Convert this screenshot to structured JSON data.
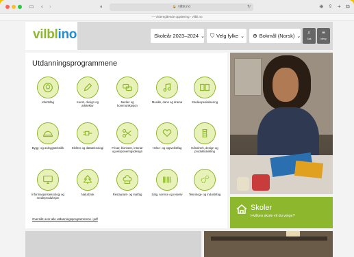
{
  "browser": {
    "url": "vilbli.no",
    "banner": "— Videregående opplæring - vilbli.no"
  },
  "header": {
    "logo_text_1": "vilbl",
    "logo_text_2": "i",
    "logo_text_3": "no",
    "school_year": "Skoleår 2023–2024",
    "county": "Velg fylke",
    "language": "Bokmål (Norsk)",
    "search_label": "Søk",
    "menu_label": "Meny"
  },
  "programs": {
    "title": "Utdanningsprogrammene",
    "items": [
      {
        "label": "Idrettsfag",
        "icon": "ball-icon"
      },
      {
        "label": "Kunst, design og arkitektur",
        "icon": "pencil-icon"
      },
      {
        "label": "Medier og kommunikasjon",
        "icon": "chat-bubbles-icon"
      },
      {
        "label": "Musikk, dans og drama",
        "icon": "music-note-icon"
      },
      {
        "label": "Studiespesialisering",
        "icon": "book-icon"
      },
      {
        "label": "Bygg- og anleggsteknikk",
        "icon": "hard-hat-icon"
      },
      {
        "label": "Elektro og datateknologi",
        "icon": "plug-icon"
      },
      {
        "label": "Frisør, blomster, interiør og eksponeringsdesign",
        "icon": "scissors-icon"
      },
      {
        "label": "Helse- og oppvekstfag",
        "icon": "heart-hands-icon"
      },
      {
        "label": "Håndverk, design og produktutvikling",
        "icon": "thread-icon"
      },
      {
        "label": "Informasjonsteknologi og medieproduksjon",
        "icon": "monitor-icon"
      },
      {
        "label": "Naturbruk",
        "icon": "tree-icon"
      },
      {
        "label": "Restaurant- og matfag",
        "icon": "chef-hat-icon"
      },
      {
        "label": "Salg, service og reiseliv",
        "icon": "barcode-icon"
      },
      {
        "label": "Teknologi- og industrifag",
        "icon": "gears-icon"
      }
    ],
    "all_link": "Oversikt over alle utdanningsprogrammene i pdf"
  },
  "skoler": {
    "title": "Skoler",
    "subtitle": "Hvilken skole vil du velge?"
  },
  "colors": {
    "brand_green": "#8db72c",
    "icon_fill": "#e8f2b8",
    "brand_blue": "#1e8fd0"
  }
}
